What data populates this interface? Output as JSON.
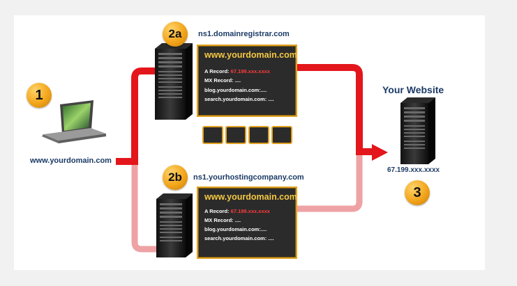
{
  "client": {
    "step": "1",
    "domain_label": "www.yourdomain.com"
  },
  "ns_a": {
    "step": "2a",
    "server_name": "ns1.domainregistrar.com",
    "box": {
      "title": "www.yourdomain.com",
      "a_record_label": "A Record:",
      "a_record_ip": "67.199.xxx.xxxx",
      "mx_record": "MX Record: ....",
      "blog": "blog.yourdomain.com:....",
      "search": "search.yourdomain.com: ...."
    }
  },
  "ns_b": {
    "step": "2b",
    "server_name": "ns1.yourhostingcompany.com",
    "box": {
      "title": "www.yourdomain.com",
      "a_record_label": "A Record:",
      "a_record_ip": "67.199.xxx.xxxx",
      "mx_record": "MX Record: ....",
      "blog": "blog.yourdomain.com:....",
      "search": "search.yourdomain.com: ...."
    }
  },
  "website": {
    "step": "3",
    "title": "Your Website",
    "ip": "67.199.xxx.xxxx"
  },
  "colors": {
    "primary_arrow": "#e3161b",
    "secondary_arrow": "#eea2a4",
    "badge": "#f2a51a",
    "box_border": "#e0a020",
    "box_bg": "#2b2b2b",
    "label_navy": "#1b3a66"
  },
  "icons": [
    "laptop-icon",
    "server-icon"
  ]
}
